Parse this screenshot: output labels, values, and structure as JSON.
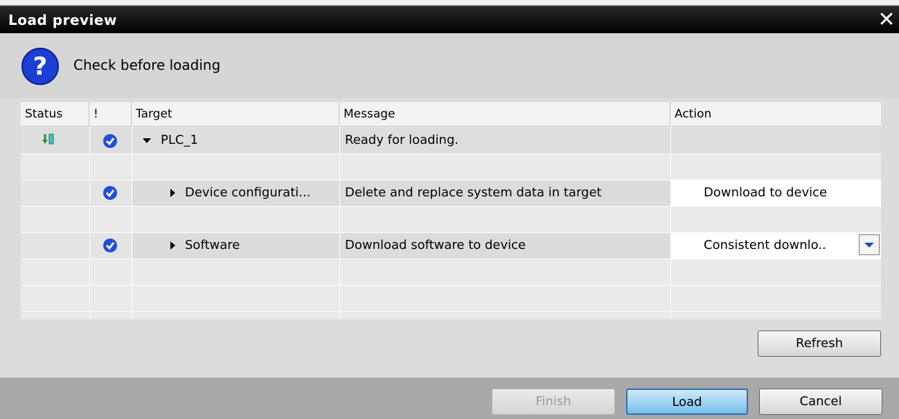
{
  "window": {
    "title": "Load preview",
    "close_glyph": "✕"
  },
  "header": {
    "icon": "question-icon",
    "text": "Check before loading"
  },
  "columns": [
    "Status",
    "!",
    "Target",
    "Message",
    "Action"
  ],
  "rows": [
    {
      "status_icon": "download-status-icon",
      "check": true,
      "expand": "expanded",
      "target": "PLC_1",
      "message": "Ready for loading.",
      "action": ""
    },
    {
      "status_icon": "",
      "check": true,
      "expand": "collapsed",
      "target": "Device configurati...",
      "message": "Delete and replace system data in target",
      "action": "Download to device"
    },
    {
      "status_icon": "",
      "check": true,
      "expand": "collapsed",
      "target": "Software",
      "message": "Download software to device",
      "action": "Consistent downlo.."
    }
  ],
  "buttons": {
    "refresh": "Refresh",
    "finish": "Finish",
    "load": "Load",
    "cancel": "Cancel"
  },
  "colors": {
    "check_blue": "#1f4ed8",
    "title_bar": "#000000",
    "primary_button": "#76bfe8"
  }
}
